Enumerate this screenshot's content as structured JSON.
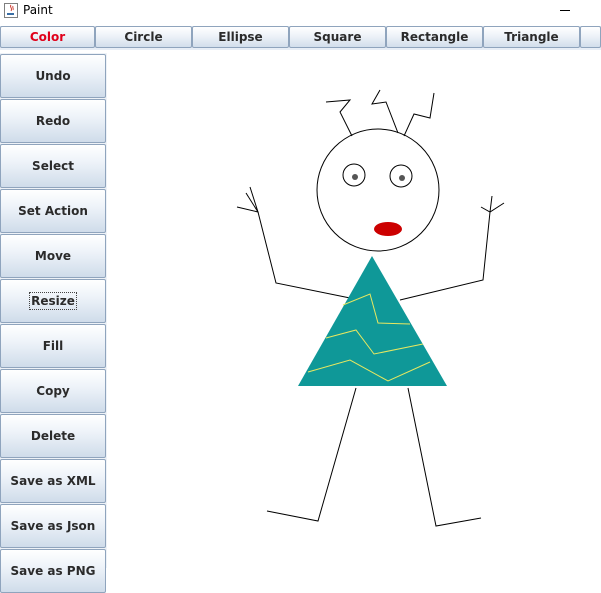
{
  "window": {
    "title": "Paint",
    "app_icon": "java-cup-icon"
  },
  "toolbar": {
    "items": [
      {
        "label": "Color",
        "active": true
      },
      {
        "label": "Circle",
        "active": false
      },
      {
        "label": "Ellipse",
        "active": false
      },
      {
        "label": "Square",
        "active": false
      },
      {
        "label": "Rectangle",
        "active": false
      },
      {
        "label": "Triangle",
        "active": false
      }
    ],
    "active_color": "#e0001a"
  },
  "actions": {
    "items": [
      {
        "label": "Undo"
      },
      {
        "label": "Redo"
      },
      {
        "label": "Select"
      },
      {
        "label": "Set Action"
      },
      {
        "label": "Move"
      },
      {
        "label": "Resize",
        "focused": true
      },
      {
        "label": "Fill"
      },
      {
        "label": "Copy"
      },
      {
        "label": "Delete"
      },
      {
        "label": "Save as XML"
      },
      {
        "label": "Save as Json"
      },
      {
        "label": "Save as PNG"
      }
    ]
  },
  "drawing": {
    "dress_fill": "#0f9898",
    "pattern_stroke": "#e8e860",
    "mouth_fill": "#cc0000",
    "pupil_fill": "#555555",
    "line_color": "#000000"
  }
}
